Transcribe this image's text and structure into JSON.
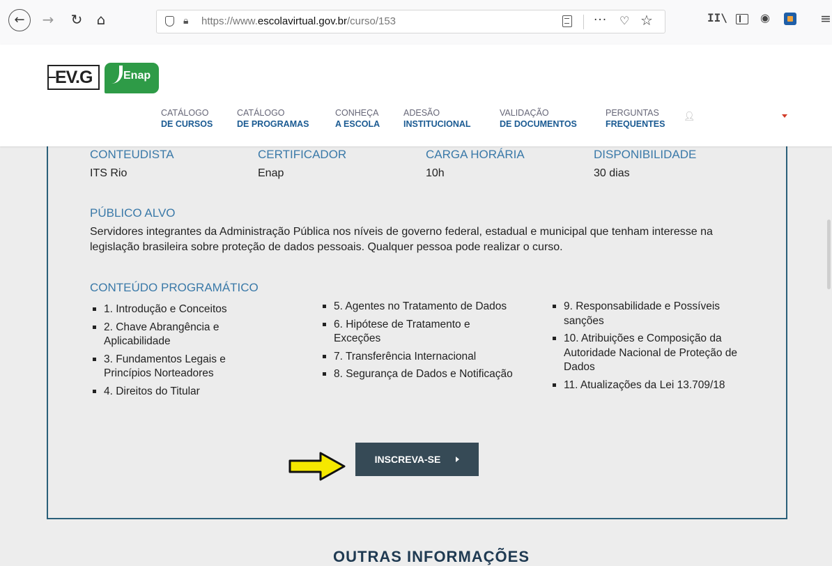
{
  "browser": {
    "url_prefix": "https://www.",
    "url_domain": "escolavirtual.gov.br",
    "url_path": "/curso/153",
    "icons": [
      "back-icon",
      "forward-icon",
      "reload-icon",
      "home-icon",
      "shield-icon",
      "lock-icon",
      "reader-icon",
      "more-icon",
      "pocket-icon",
      "bookmark-star-icon",
      "library-icon",
      "sidebar-icon",
      "account-icon",
      "extension-icon",
      "menu-icon"
    ]
  },
  "header": {
    "logo_evg": "EV.G",
    "logo_enap": "Enap",
    "nav": [
      {
        "top": "CATÁLOGO",
        "bottom": "DE CURSOS"
      },
      {
        "top": "CATÁLOGO",
        "bottom": "DE PROGRAMAS"
      },
      {
        "top": "CONHEÇA",
        "bottom": "A ESCOLA"
      },
      {
        "top": "ADESÃO",
        "bottom": "INSTITUCIONAL"
      },
      {
        "top": "VALIDAÇÃO",
        "bottom": "DE DOCUMENTOS"
      },
      {
        "top": "PERGUNTAS",
        "bottom": "FREQUENTES"
      }
    ]
  },
  "course": {
    "info": [
      {
        "label": "CONTEUDISTA",
        "value": "ITS Rio"
      },
      {
        "label": "CERTIFICADOR",
        "value": "Enap"
      },
      {
        "label": "CARGA HORÁRIA",
        "value": "10h"
      },
      {
        "label": "DISPONIBILIDADE",
        "value": "30 dias"
      }
    ],
    "audience_label": "PÚBLICO ALVO",
    "audience_text": "Servidores integrantes da Administração Pública nos níveis de governo federal, estadual e municipal que tenham interesse na legislação brasileira sobre proteção de dados pessoais. Qualquer pessoa pode realizar o curso.",
    "program_label": "CONTEÚDO PROGRAMÁTICO",
    "topics": [
      "1. Introdução e Conceitos",
      "2. Chave Abrangência e Aplicabilidade",
      "3. Fundamentos Legais e Princípios Norteadores",
      "4. Direitos do Titular",
      "5. Agentes no Tratamento de Dados",
      "6. Hipótese de Tratamento e Exceções",
      "7. Transferência Internacional",
      "8. Segurança de Dados e Notificação",
      "9. Responsabilidade e Possíveis sanções",
      "10. Atribuições e Composição da Autoridade Nacional de Proteção de Dados",
      "11. Atualizações da Lei 13.709/18"
    ],
    "subscribe_label": "INSCREVA-SE"
  },
  "footer": {
    "other_info": "OUTRAS INFORMAÇÕES"
  },
  "colors": {
    "accent_blue": "#3a79a8",
    "nav_blue": "#1a5a92",
    "button_dark": "#364a56",
    "card_border": "#2a5f79",
    "enap_green": "#2e9b47",
    "pointer_yellow": "#f5e800"
  }
}
